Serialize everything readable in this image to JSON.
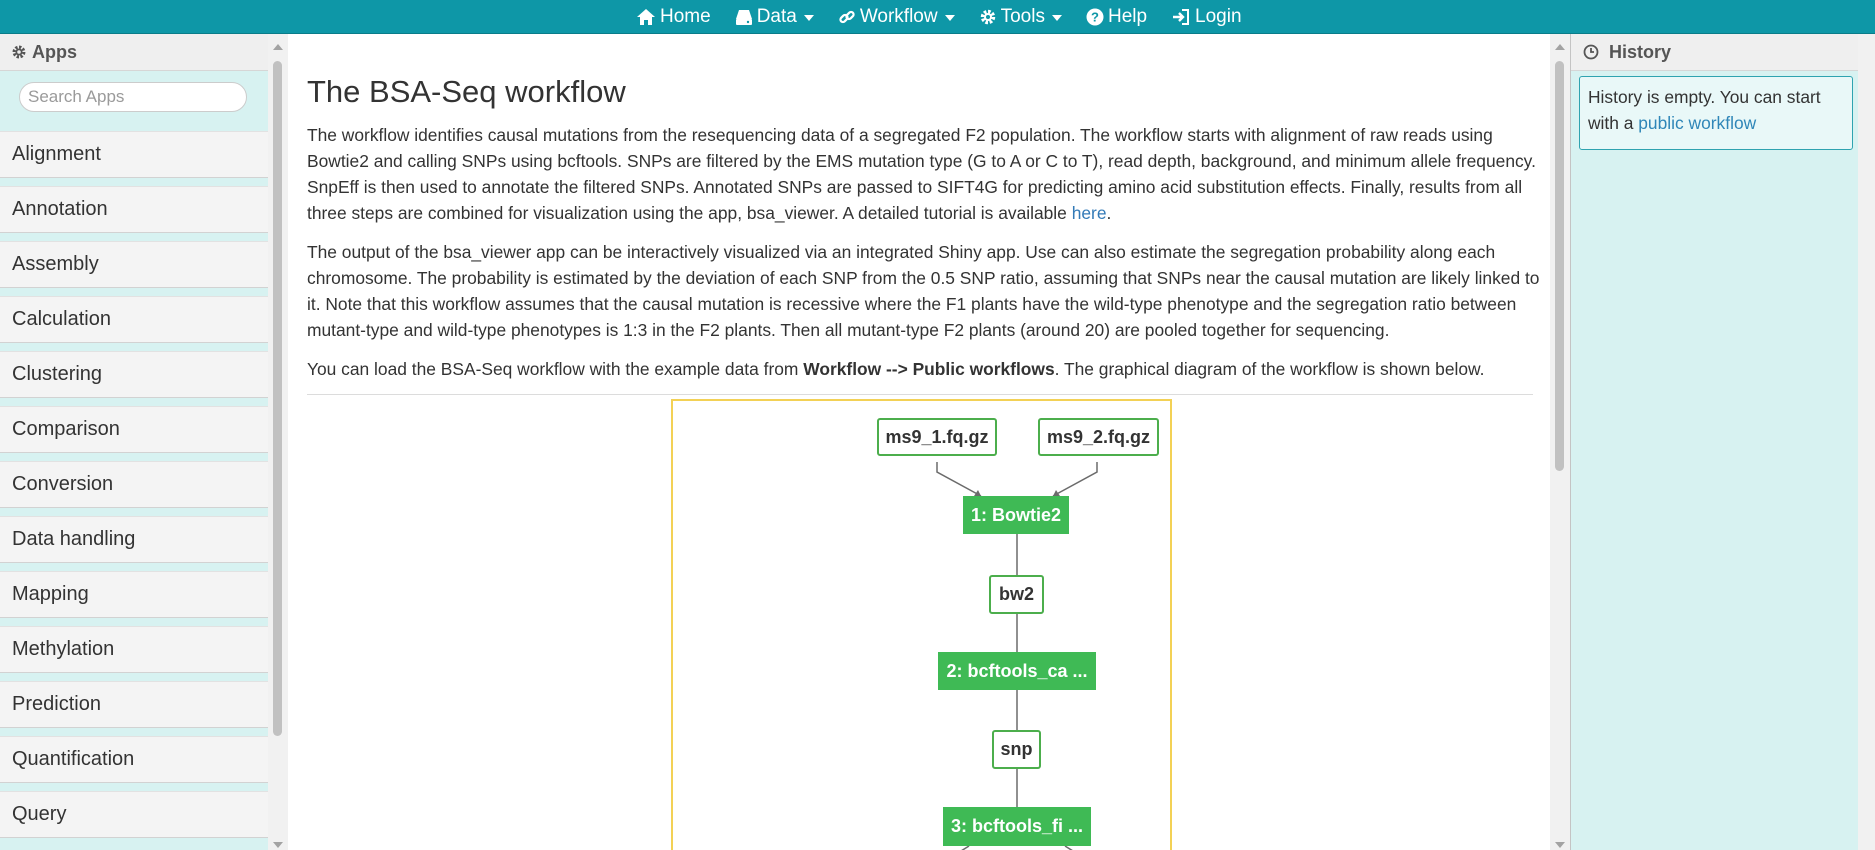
{
  "navbar": {
    "items": [
      {
        "label": "Home",
        "icon": "home-icon",
        "dropdown": false
      },
      {
        "label": "Data",
        "icon": "drive-icon",
        "dropdown": true
      },
      {
        "label": "Workflow",
        "icon": "link-icon",
        "dropdown": true
      },
      {
        "label": "Tools",
        "icon": "gear-icon",
        "dropdown": true
      },
      {
        "label": "Help",
        "icon": "question-icon",
        "dropdown": false
      },
      {
        "label": "Login",
        "icon": "login-icon",
        "dropdown": false
      }
    ]
  },
  "apps_panel": {
    "title": "Apps",
    "search_placeholder": "Search Apps",
    "items": [
      "Alignment",
      "Annotation",
      "Assembly",
      "Calculation",
      "Clustering",
      "Comparison",
      "Conversion",
      "Data handling",
      "Mapping",
      "Methylation",
      "Prediction",
      "Quantification",
      "Query"
    ]
  },
  "main": {
    "title": "The BSA-Seq workflow",
    "para1": "The workflow identifies causal mutations from the resequencing data of a segregated F2 population. The workflow starts with alignment of raw reads using Bowtie2 and calling SNPs using bcftools. SNPs are filtered by the EMS mutation type (G to A or C to T), read depth, background, and minimum allele frequency. SnpEff is then used to annotate the filtered SNPs. Annotated SNPs are passed to SIFT4G for predicting amino acid substitution effects. Finally, results from all three steps are combined for visualization using the app, bsa_viewer. A detailed tutorial is available ",
    "para1_link": "here",
    "para1_end": ".",
    "para2": "The output of the bsa_viewer app can be interactively visualized via an integrated Shiny app. Use can also estimate the segregation probability along each chromosome. The probability is estimated by the deviation of each SNP from the 0.5 SNP ratio, assuming that SNPs near the causal mutation are likely linked to it. Note that this workflow assumes that the causal mutation is recessive where the F1 plants have the wild-type phenotype and the segregation ratio between mutant-type and wild-type phenotypes is 1:3 in the F2 plants. Then all mutant-type F2 plants (around 20) are pooled together for sequencing.",
    "para3_start": "You can load the BSA-Seq workflow with the example data from ",
    "para3_bold": "Workflow --> Public workflows",
    "para3_end": ". The graphical diagram of the workflow is shown below."
  },
  "diagram": {
    "input1": "ms9_1.fq.gz",
    "input2": "ms9_2.fq.gz",
    "step1": "1: Bowtie2",
    "out1": "bw2",
    "step2": "2: bcftools_ca ...",
    "out2": "snp",
    "step3": "3: bcftools_fi ...",
    "colors": {
      "step_fill": "#3fba55",
      "border": "#4cae4c",
      "frame": "#f3d155"
    }
  },
  "history_panel": {
    "title": "History",
    "empty_text": "History is empty. You can start with a ",
    "link": "public workflow"
  },
  "colors": {
    "navbar": "#0e97a7",
    "panel_bg": "#d7f2f1",
    "link": "#337ab7"
  }
}
